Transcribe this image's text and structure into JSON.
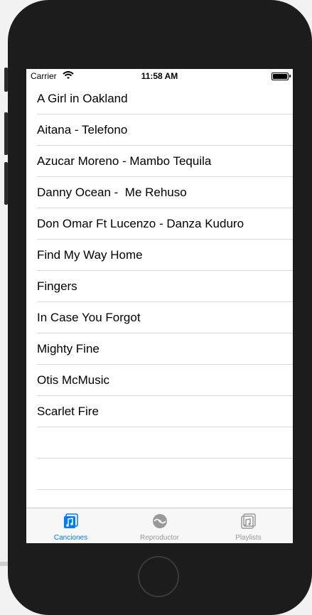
{
  "status_bar": {
    "carrier": "Carrier",
    "time": "11:58 AM"
  },
  "songs": [
    "A Girl in Oakland",
    "Aitana - Telefono",
    "Azucar Moreno - Mambo Tequila",
    "Danny Ocean -  Me Rehuso",
    "Don Omar Ft Lucenzo - Danza Kuduro",
    "Find My Way Home",
    "Fingers",
    "In Case You Forgot",
    "Mighty Fine",
    "Otis McMusic",
    "Scarlet Fire"
  ],
  "tabs": [
    {
      "label": "Canciones",
      "icon": "music-note-icon",
      "active": true
    },
    {
      "label": "Reproductor",
      "icon": "player-disc-icon",
      "active": false
    },
    {
      "label": "Playlists",
      "icon": "playlist-icon",
      "active": false
    }
  ],
  "colors": {
    "accent": "#007aff",
    "inactive_tab": "#999999",
    "separator": "#d8d8d8",
    "device_body": "#1c1c1c"
  }
}
